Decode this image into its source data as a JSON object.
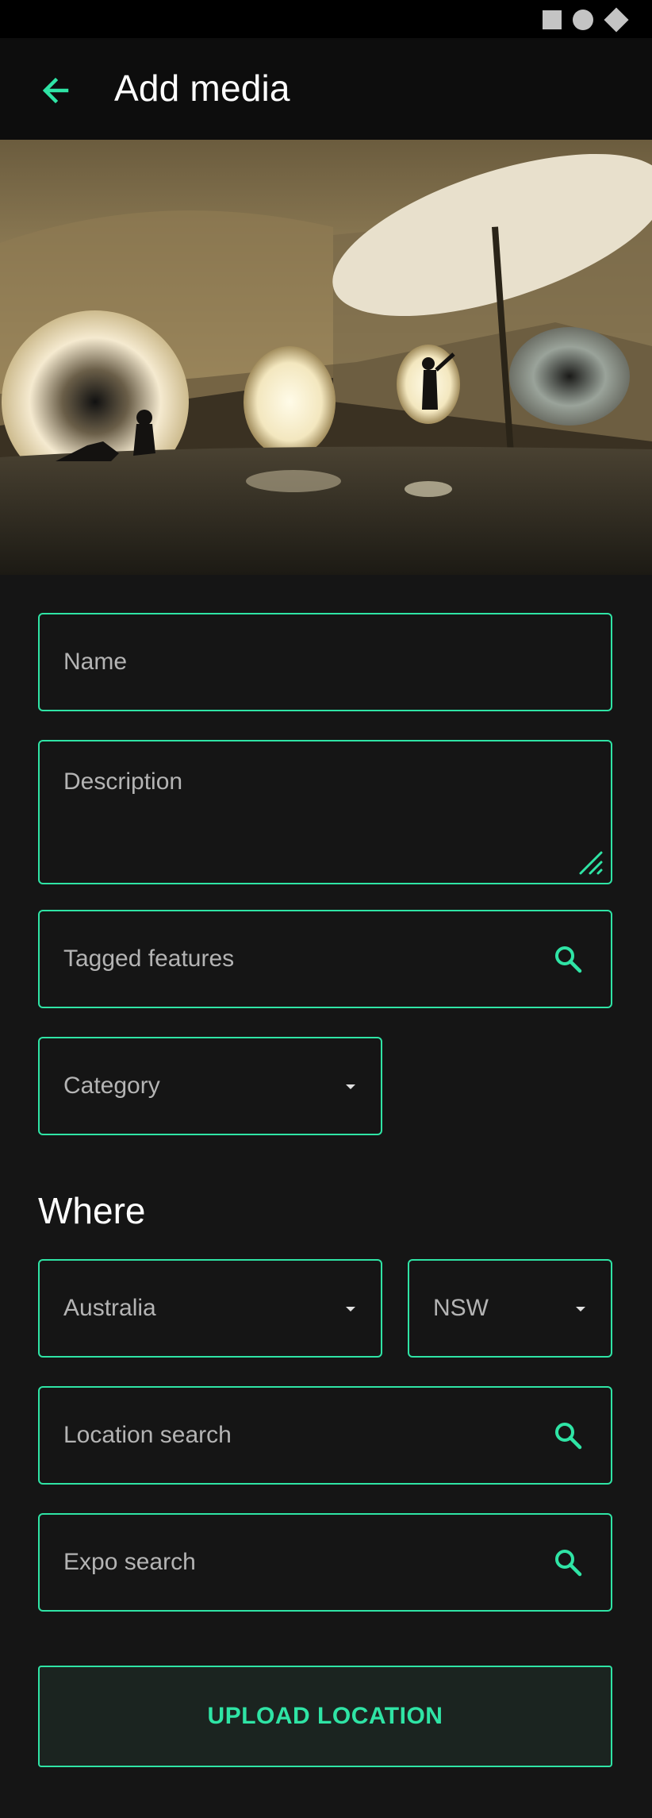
{
  "app_bar": {
    "title": "Add media"
  },
  "form": {
    "name_label": "Name",
    "description_label": "Description",
    "tagged_features_label": "Tagged features",
    "category_label": "Category"
  },
  "where": {
    "heading": "Where",
    "country": "Australia",
    "state": "NSW",
    "location_search_label": "Location search",
    "expo_search_label": "Expo search"
  },
  "upload_button": {
    "label": "UPLOAD LOCATION"
  },
  "colors": {
    "accent": "#2fe4a5",
    "background": "#151515",
    "app_bar": "#0d0d0d"
  }
}
